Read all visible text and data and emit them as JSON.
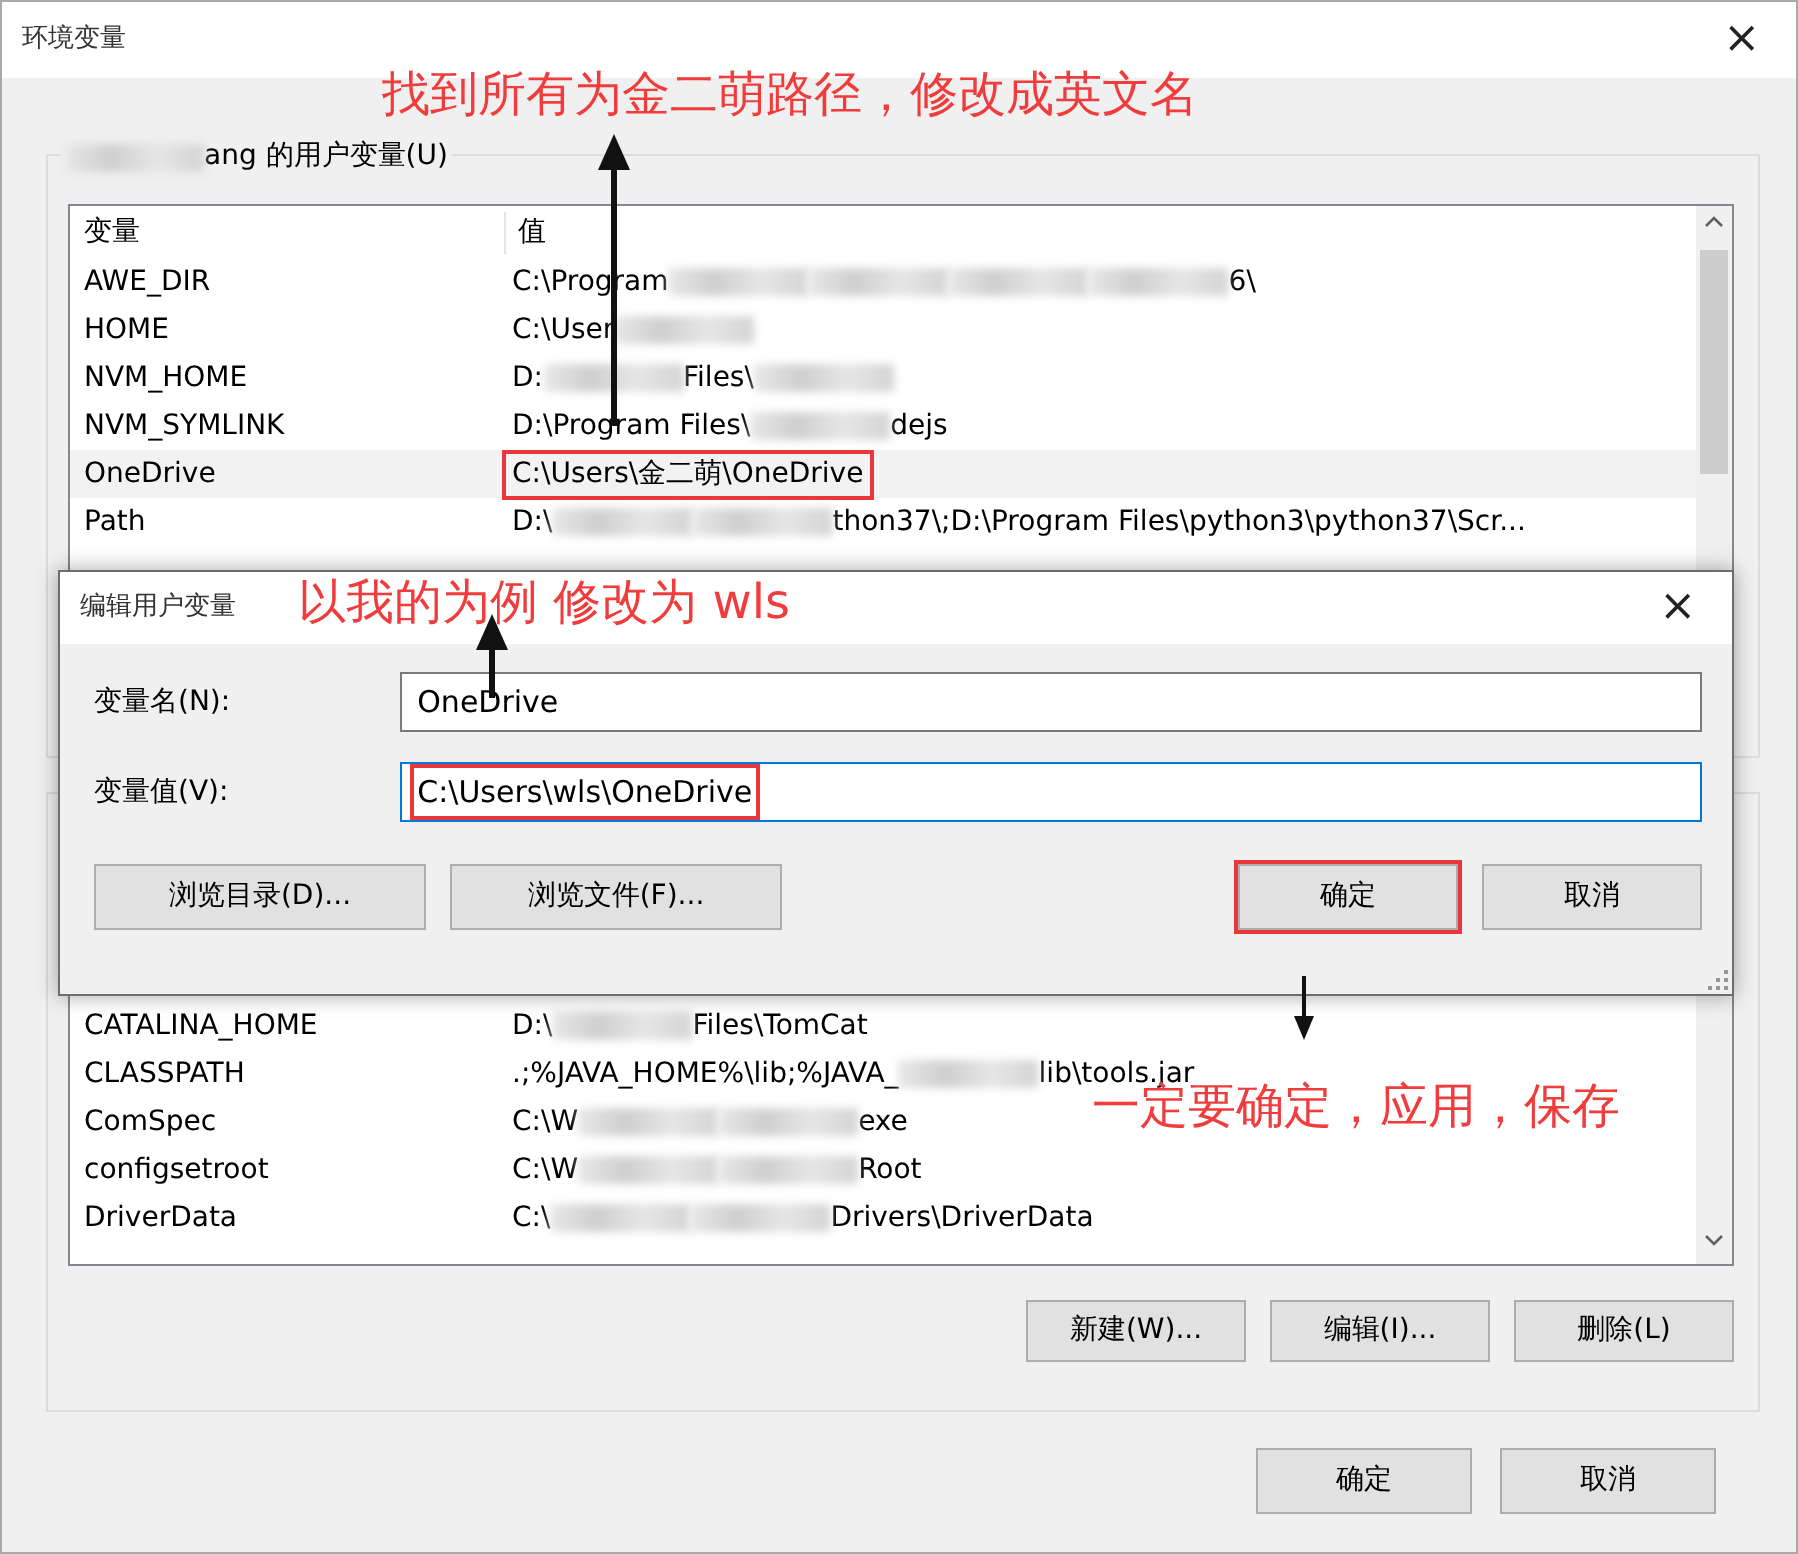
{
  "window": {
    "title": "环境变量",
    "close": "×"
  },
  "annotations": [
    {
      "text": "找到所有为金二萌路径，修改成英文名"
    },
    {
      "text": "以我的为例 修改为 wls"
    },
    {
      "text": "一定要确定，应用，保存"
    }
  ],
  "user_group": {
    "label": [
      {
        "kind": "blur"
      },
      {
        "kind": "text",
        "text": "ang 的用户变量(U)"
      }
    ],
    "columns": [
      "变量",
      "值"
    ],
    "rows": [
      {
        "name": "AWE_DIR",
        "selected": false,
        "annotated": false,
        "value": [
          {
            "kind": "text",
            "text": "C:\\Program"
          },
          {
            "kind": "blur"
          },
          {
            "kind": "blur"
          },
          {
            "kind": "blur"
          },
          {
            "kind": "blur"
          },
          {
            "kind": "text",
            "text": "6\\"
          }
        ]
      },
      {
        "name": "HOME",
        "selected": false,
        "annotated": false,
        "value": [
          {
            "kind": "text",
            "text": "C:\\User"
          },
          {
            "kind": "blur"
          }
        ]
      },
      {
        "name": "NVM_HOME",
        "selected": false,
        "annotated": false,
        "value": [
          {
            "kind": "text",
            "text": "D:"
          },
          {
            "kind": "blur"
          },
          {
            "kind": "text",
            "text": "Files\\"
          },
          {
            "kind": "blur"
          }
        ]
      },
      {
        "name": "NVM_SYMLINK",
        "selected": false,
        "annotated": false,
        "value": [
          {
            "kind": "text",
            "text": "D:\\Program Files\\"
          },
          {
            "kind": "blur"
          },
          {
            "kind": "text",
            "text": "dejs"
          }
        ]
      },
      {
        "name": "OneDrive",
        "selected": true,
        "annotated": true,
        "value": [
          {
            "kind": "text",
            "text": "C:\\Users\\金二萌\\OneDrive"
          }
        ]
      },
      {
        "name": "Path",
        "selected": false,
        "annotated": false,
        "value": [
          {
            "kind": "text",
            "text": "D:\\"
          },
          {
            "kind": "blur"
          },
          {
            "kind": "blur"
          },
          {
            "kind": "text",
            "text": "thon37\\;D:\\Program Files\\python3\\python37\\Scr..."
          }
        ]
      }
    ]
  },
  "system_group": {
    "rows": [
      {
        "name": "CATALINA_HOME",
        "value": [
          {
            "kind": "text",
            "text": "D:\\"
          },
          {
            "kind": "blur"
          },
          {
            "kind": "text",
            "text": "Files\\TomCat"
          }
        ]
      },
      {
        "name": "CLASSPATH",
        "value": [
          {
            "kind": "text",
            "text": ".;%JAVA_HOME%\\lib;%JAVA_"
          },
          {
            "kind": "blur"
          },
          {
            "kind": "text",
            "text": "lib\\tools.jar"
          }
        ]
      },
      {
        "name": "ComSpec",
        "value": [
          {
            "kind": "text",
            "text": "C:\\W"
          },
          {
            "kind": "blur"
          },
          {
            "kind": "blur"
          },
          {
            "kind": "text",
            "text": "exe"
          }
        ]
      },
      {
        "name": "configsetroot",
        "value": [
          {
            "kind": "text",
            "text": "C:\\W"
          },
          {
            "kind": "blur"
          },
          {
            "kind": "blur"
          },
          {
            "kind": "text",
            "text": "Root"
          }
        ]
      },
      {
        "name": "DriverData",
        "value": [
          {
            "kind": "text",
            "text": "C:\\"
          },
          {
            "kind": "blur"
          },
          {
            "kind": "blur"
          },
          {
            "kind": "text",
            "text": "Drivers\\DriverData"
          }
        ]
      }
    ],
    "buttons": [
      "新建(W)...",
      "编辑(I)...",
      "删除(L)"
    ]
  },
  "footer_buttons": [
    "确定",
    "取消"
  ],
  "edit_dialog": {
    "title": "编辑用户变量",
    "close": "×",
    "fields": [
      {
        "label": "变量名(N):",
        "value": "OneDrive",
        "focused": false,
        "annotated": false
      },
      {
        "label": "变量值(V):",
        "value": "C:\\Users\\wls\\OneDrive",
        "focused": true,
        "annotated": true
      }
    ],
    "buttons": [
      {
        "label": "浏览目录(D)...",
        "annotated": false
      },
      {
        "label": "浏览文件(F)...",
        "annotated": false
      },
      {
        "label": "确定",
        "annotated": true
      },
      {
        "label": "取消",
        "annotated": false
      }
    ]
  }
}
